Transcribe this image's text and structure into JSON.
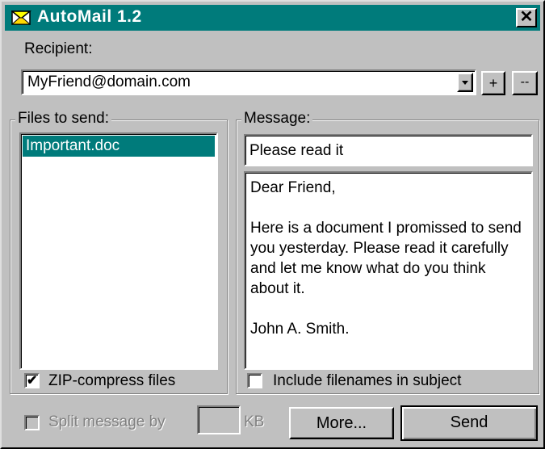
{
  "window": {
    "title": "AutoMail 1.2",
    "close_glyph": "✕",
    "accent_color": "#007b7b"
  },
  "recipient": {
    "label": "Recipient:",
    "value": "MyFriend@domain.com",
    "add_label": "+",
    "remove_label": "--"
  },
  "files": {
    "group_label": "Files to send:",
    "items": [
      "Important.doc"
    ],
    "zip_label": "ZIP-compress files",
    "zip_checked": true
  },
  "message": {
    "group_label": "Message:",
    "subject": "Please read it",
    "body": "Dear Friend,\n\nHere is a document I promissed to send you yesterday. Please read it carefully and let me know what do you think about it.\n\nJohn A. Smith.",
    "include_filenames_label": "Include filenames in subject",
    "include_filenames_checked": false
  },
  "footer": {
    "split_label": "Split message by",
    "split_value": "",
    "kb_label": "KB",
    "more_label": "More...",
    "send_label": "Send"
  }
}
